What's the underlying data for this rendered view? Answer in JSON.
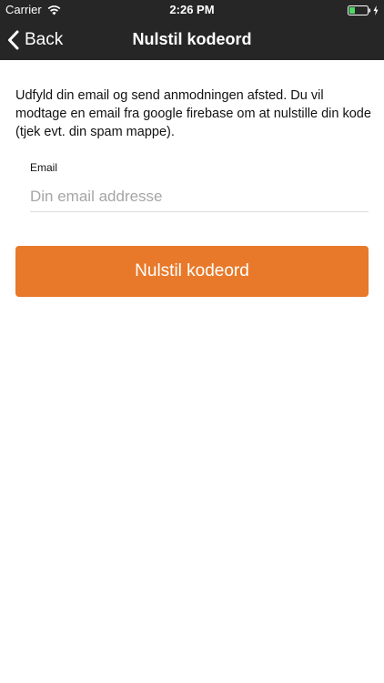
{
  "status_bar": {
    "carrier": "Carrier",
    "time": "2:26 PM",
    "icons": [
      "wifi-icon",
      "battery-icon",
      "charging-bolt-icon"
    ]
  },
  "nav": {
    "back_label": "Back",
    "back_icon": "chevron-left-icon",
    "title": "Nulstil kodeord"
  },
  "content": {
    "description": "Udfyld din email og send anmodningen afsted. Du vil modtage en email fra google firebase om at nulstille din kode (tjek evt. din spam mappe).",
    "email_label": "Email",
    "email_value": "",
    "email_placeholder": "Din email addresse",
    "submit_label": "Nulstil kodeord"
  },
  "colors": {
    "nav_background": "#262626",
    "accent": "#e8792a",
    "battery_fill": "#4cd964"
  }
}
